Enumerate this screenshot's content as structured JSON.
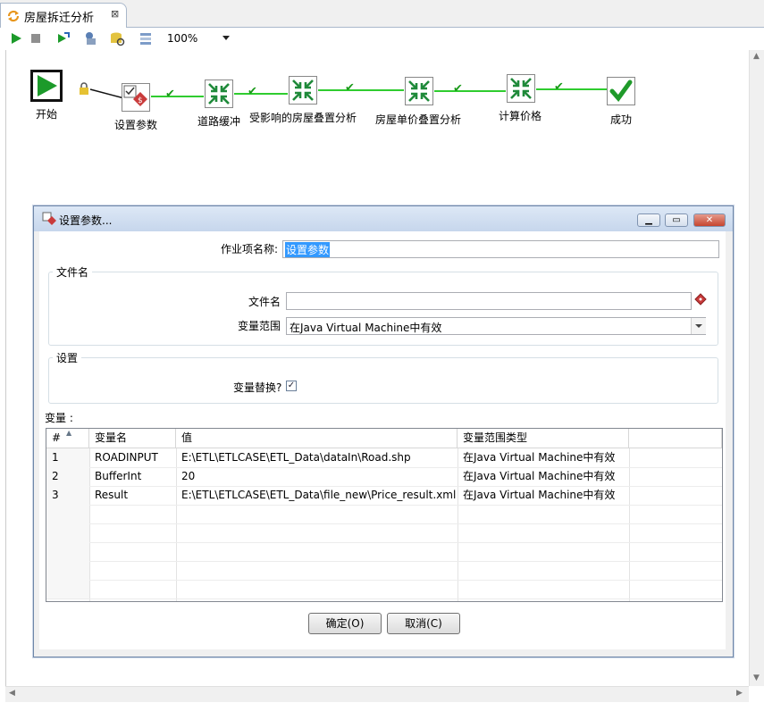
{
  "tab": {
    "title": "房屋拆迁分析",
    "close": "⊠"
  },
  "toolbar": {
    "zoom": "100%"
  },
  "workflow": {
    "start_label": "开始",
    "nodes": [
      {
        "label": "设置参数"
      },
      {
        "label": "道路缓冲"
      },
      {
        "label": "受影响的房屋叠置分析"
      },
      {
        "label": "房屋单价叠置分析"
      },
      {
        "label": "计算价格"
      },
      {
        "label": "成功"
      }
    ]
  },
  "dialog": {
    "title": "设置参数...",
    "job_name_label": "作业项名称:",
    "job_name_value": "设置参数",
    "file_group_title": "文件名",
    "file_label": "文件名",
    "file_value": "",
    "scope_label": "变量范围",
    "scope_value": "在Java Virtual Machine中有效",
    "settings_group_title": "设置",
    "replace_label": "变量替换?",
    "replace_checked": "✓",
    "vars_label": "变量 :",
    "table": {
      "headers": [
        "#",
        "变量名",
        "值",
        "变量范围类型"
      ],
      "rows": [
        [
          "1",
          "ROADINPUT",
          "E:\\ETL\\ETLCASE\\ETL_Data\\dataIn\\Road.shp",
          "在Java Virtual Machine中有效"
        ],
        [
          "2",
          "BufferInt",
          "20",
          "在Java Virtual Machine中有效"
        ],
        [
          "3",
          "Result",
          "E:\\ETL\\ETLCASE\\ETL_Data\\file_new\\Price_result.xml",
          "在Java Virtual Machine中有效"
        ]
      ]
    },
    "ok_label": "确定(O)",
    "cancel_label": "取消(C)"
  }
}
